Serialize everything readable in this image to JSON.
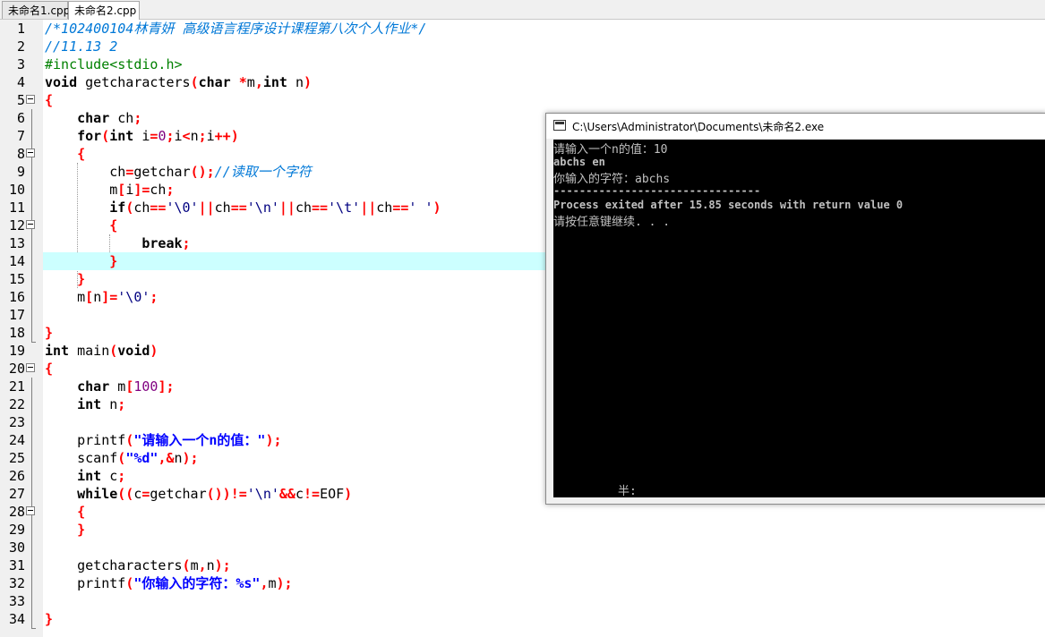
{
  "tabs": [
    {
      "label": "未命名1.cpp"
    },
    {
      "label": "未命名2.cpp"
    }
  ],
  "editor": {
    "line_numbers": [
      "1",
      "2",
      "3",
      "4",
      "5",
      "6",
      "7",
      "8",
      "9",
      "10",
      "11",
      "12",
      "13",
      "14",
      "15",
      "16",
      "17",
      "18",
      "19",
      "20",
      "21",
      "22",
      "23",
      "24",
      "25",
      "26",
      "27",
      "28",
      "29",
      "30",
      "31",
      "32",
      "33",
      "34"
    ],
    "highlight_color": "#ccffff"
  },
  "console": {
    "title": "C:\\Users\\Administrator\\Documents\\未命名2.exe",
    "lines": [
      "请输入一个n的值：10",
      "abchs en",
      "你输入的字符：abchs",
      "--------------------------------",
      "Process exited after 15.85 seconds with return value 0",
      "请按任意键继续. . ."
    ],
    "ime_status": "半:"
  }
}
